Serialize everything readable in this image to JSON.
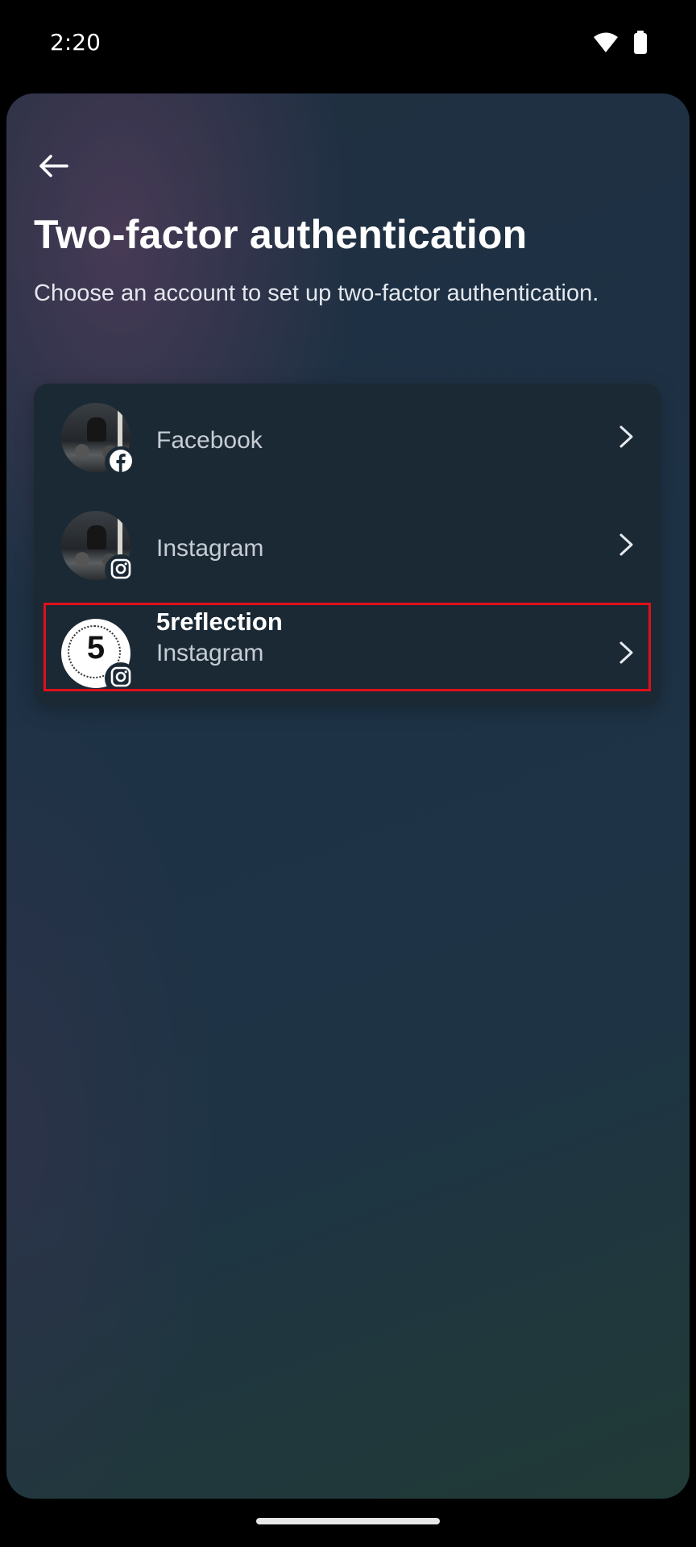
{
  "status_bar": {
    "time": "2:20",
    "icons": [
      "wifi-icon",
      "battery-icon"
    ]
  },
  "header": {
    "back_icon": "arrow-left-icon",
    "title": "Two-factor authentication",
    "subtitle": "Choose an account to set up two-factor authentication."
  },
  "accounts": [
    {
      "username": "",
      "platform": "Facebook",
      "badge_icon": "facebook-icon",
      "selected": false
    },
    {
      "username": "",
      "platform": "Instagram",
      "badge_icon": "instagram-icon",
      "selected": false
    },
    {
      "username": "5reflection",
      "platform": "Instagram",
      "badge_icon": "instagram-icon",
      "selected": true
    }
  ],
  "colors": {
    "highlight": "#e0101a",
    "text_primary": "#ffffff",
    "text_secondary": "#c5ccd4",
    "card": "#1b2935"
  }
}
